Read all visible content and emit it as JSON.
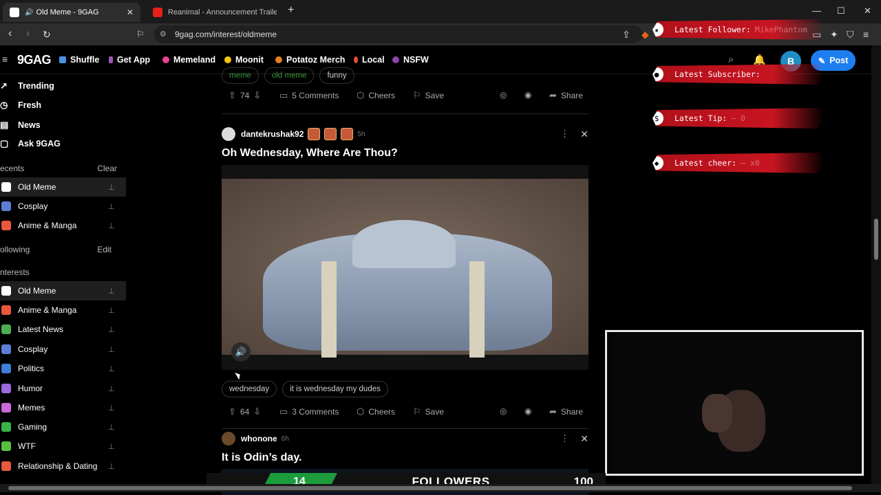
{
  "browser": {
    "tabs": [
      {
        "title": "Old Meme - 9GAG",
        "favicon_color": "#ffffff",
        "audio": true
      },
      {
        "title": "Reanimal - Announcement Trailer | PS",
        "favicon_color": "#e62117"
      }
    ],
    "url": "9gag.com/interest/oldmeme"
  },
  "header": {
    "logo": "9GAG",
    "nav": [
      {
        "label": "Shuffle",
        "icon": "shuffle-icon",
        "color": "#4a90e2"
      },
      {
        "label": "Get App",
        "icon": "phone-icon",
        "color": "#9b59b6"
      },
      {
        "label": "Memeland",
        "icon": "memeland-icon",
        "color": "#e84393"
      },
      {
        "label": "Moonit",
        "icon": "moon-icon",
        "color": "#f1c40f"
      },
      {
        "label": "Potatoz Merch",
        "icon": "potato-icon",
        "color": "#e67e22"
      },
      {
        "label": "Local",
        "icon": "pin-icon",
        "color": "#e74c3c"
      },
      {
        "label": "NSFW",
        "icon": "nsfw-icon",
        "color": "#8e44ad"
      }
    ],
    "avatar_letter": "B",
    "post_label": "Post"
  },
  "sidebar": {
    "main": [
      "Trending",
      "Fresh",
      "News",
      "Ask 9GAG"
    ],
    "recents_label": "ecents",
    "clear_label": "Clear",
    "recents": [
      {
        "label": "Old Meme",
        "color": "#ffffff",
        "selected": true
      },
      {
        "label": "Cosplay",
        "color": "#5b7fd6"
      },
      {
        "label": "Anime & Manga",
        "color": "#e9573f"
      }
    ],
    "following_label": "ollowing",
    "edit_label": "Edit",
    "interests_label": "nterests",
    "interests": [
      {
        "label": "Old Meme",
        "color": "#ffffff",
        "selected": true
      },
      {
        "label": "Anime & Manga",
        "color": "#e9573f"
      },
      {
        "label": "Latest News",
        "color": "#4caf50"
      },
      {
        "label": "Cosplay",
        "color": "#5b7fd6"
      },
      {
        "label": "Politics",
        "color": "#3f7fd9"
      },
      {
        "label": "Humor",
        "color": "#9c6ade"
      },
      {
        "label": "Memes",
        "color": "#c96ad6"
      },
      {
        "label": "Gaming",
        "color": "#3bb34a"
      },
      {
        "label": "WTF",
        "color": "#56c13f"
      },
      {
        "label": "Relationship & Dating",
        "color": "#e9573f"
      }
    ]
  },
  "feed": {
    "top_tags": [
      "meme",
      "old meme",
      "funny"
    ],
    "top_actions": {
      "votes": "74",
      "comments": "5 Comments",
      "cheers": "Cheers",
      "save": "Save",
      "share": "Share"
    },
    "post1": {
      "user": "dantekrushak92",
      "time": "5h",
      "title": "Oh Wednesday, Where Are Thou?",
      "tags": [
        "wednesday",
        "it is wednesday my dudes"
      ],
      "votes": "64",
      "comments": "3 Comments",
      "cheers": "Cheers",
      "save": "Save",
      "share": "Share"
    },
    "post2": {
      "user": "whonone",
      "time": "6h",
      "title": "It is Odin’s day."
    }
  },
  "overlay": {
    "alerts": [
      {
        "label": "Latest Follower:",
        "value": "MikePhantom",
        "icon": "star-icon"
      },
      {
        "label": "Latest Subscriber:",
        "value": "",
        "icon": "person-icon"
      },
      {
        "label": "Latest Tip:",
        "value": "– 0",
        "icon": "dollar-icon"
      },
      {
        "label": "Latest cheer:",
        "value": "– x0",
        "icon": "diamond-icon"
      }
    ],
    "followers": {
      "count": "14",
      "label": "FOLLOWERS",
      "goal": "100"
    }
  }
}
